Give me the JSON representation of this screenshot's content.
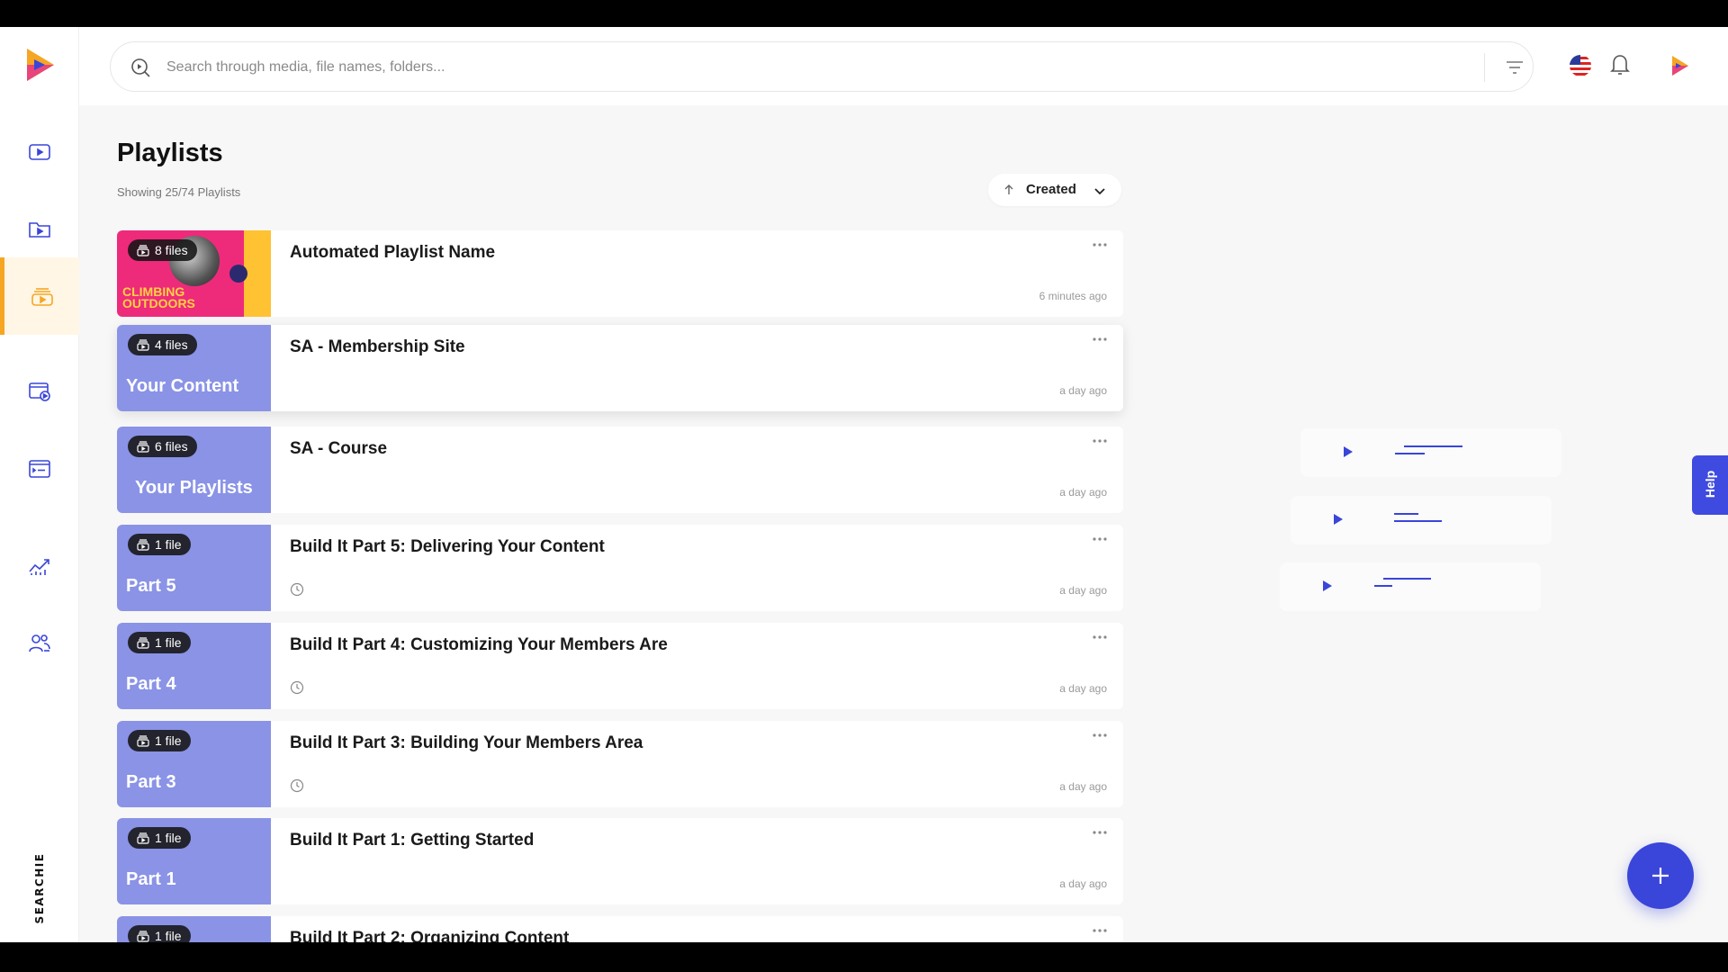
{
  "app": {
    "brand": "SEARCHIE",
    "accent": "#3a45d9",
    "active_color": "#f5a623"
  },
  "search": {
    "placeholder": "Search through media, file names, folders..."
  },
  "sidebar": {
    "items": [
      {
        "icon": "video-icon",
        "active": false
      },
      {
        "icon": "folder-video-icon",
        "active": false
      },
      {
        "icon": "playlist-icon",
        "active": true
      },
      {
        "icon": "channel-icon",
        "active": false
      },
      {
        "icon": "widget-icon",
        "active": false
      },
      {
        "icon": "analytics-icon",
        "active": false
      },
      {
        "icon": "contacts-icon",
        "active": false
      }
    ]
  },
  "main": {
    "title": "Playlists",
    "subtitle": "Showing 25/74 Playlists",
    "sort_label": "Created"
  },
  "playlists": [
    {
      "title": "Automated Playlist Name",
      "files": "8 files",
      "time": "6 minutes ago",
      "thumb_text": "",
      "thumb_lines": [
        "CLIMBING",
        "OUTDOORS"
      ],
      "clock": false
    },
    {
      "title": "SA - Membership Site",
      "files": "4 files",
      "time": "a day ago",
      "thumb_text": "Your Content",
      "clock": false
    },
    {
      "title": "SA - Course",
      "files": "6 files",
      "time": "a day ago",
      "thumb_text": "Your Playlists",
      "clock": false
    },
    {
      "title": "Build It Part 5: Delivering Your Content",
      "files": "1 file",
      "time": "a day ago",
      "thumb_text": "Part 5",
      "clock": true
    },
    {
      "title": "Build It Part 4: Customizing Your Members Are",
      "files": "1 file",
      "time": "a day ago",
      "thumb_text": "Part 4",
      "clock": true
    },
    {
      "title": "Build It Part 3: Building Your Members Area",
      "files": "1 file",
      "time": "a day ago",
      "thumb_text": "Part 3",
      "clock": true
    },
    {
      "title": "Build It Part 1: Getting Started",
      "files": "1 file",
      "time": "a day ago",
      "thumb_text": "Part 1",
      "clock": false
    },
    {
      "title": "Build It Part 2: Organizing Content",
      "files": "1 file",
      "time": "",
      "thumb_text": "",
      "clock": false
    }
  ],
  "help_label": "Help"
}
